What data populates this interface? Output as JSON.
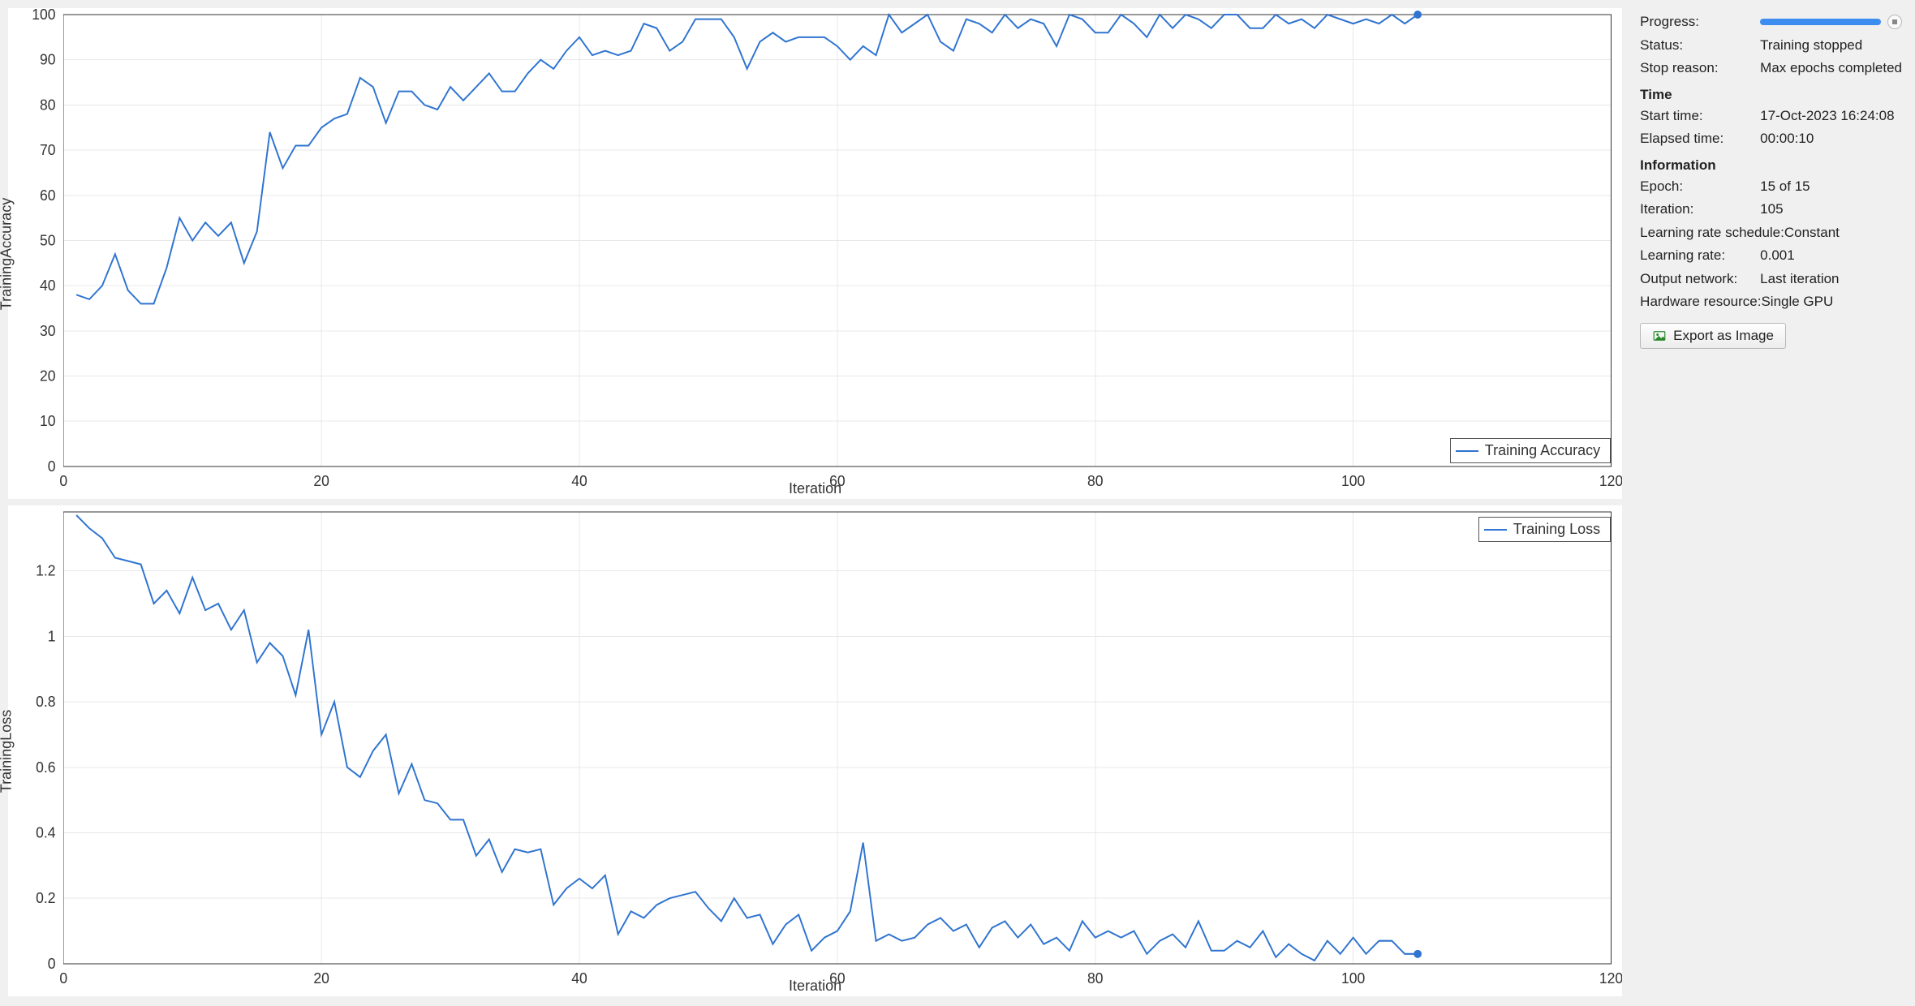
{
  "info": {
    "progress_label": "Progress:",
    "progress_pct": 100,
    "status_label": "Status:",
    "status_value": "Training stopped",
    "stopreason_label": "Stop reason:",
    "stopreason_value": "Max epochs completed",
    "time_header": "Time",
    "starttime_label": "Start time:",
    "starttime_value": "17-Oct-2023 16:24:08",
    "elapsed_label": "Elapsed time:",
    "elapsed_value": "00:00:10",
    "information_header": "Information",
    "epoch_label": "Epoch:",
    "epoch_value": "15 of 15",
    "iteration_label": "Iteration:",
    "iteration_value": "105",
    "lrsched_label": "Learning rate schedule:",
    "lrsched_value": "Constant",
    "lrate_label": "Learning rate:",
    "lrate_value": "0.001",
    "outnet_label": "Output network:",
    "outnet_value": "Last iteration",
    "hw_label": "Hardware resource:",
    "hw_value": "Single GPU",
    "export_label": "Export as Image"
  },
  "chart_data": [
    {
      "id": "accuracy",
      "type": "line",
      "xlabel": "Iteration",
      "ylabel": "TrainingAccuracy",
      "xlim": [
        0,
        120
      ],
      "ylim": [
        0,
        100
      ],
      "xticks": [
        0,
        20,
        40,
        60,
        80,
        100,
        120
      ],
      "yticks": [
        0,
        10,
        20,
        30,
        40,
        50,
        60,
        70,
        80,
        90,
        100
      ],
      "legend_pos": "bottom-right",
      "series": [
        {
          "name": "Training Accuracy",
          "color": "#2f74d0",
          "x": [
            1,
            2,
            3,
            4,
            5,
            6,
            7,
            8,
            9,
            10,
            11,
            12,
            13,
            14,
            15,
            16,
            17,
            18,
            19,
            20,
            21,
            22,
            23,
            24,
            25,
            26,
            27,
            28,
            29,
            30,
            31,
            32,
            33,
            34,
            35,
            36,
            37,
            38,
            39,
            40,
            41,
            42,
            43,
            44,
            45,
            46,
            47,
            48,
            49,
            50,
            51,
            52,
            53,
            54,
            55,
            56,
            57,
            58,
            59,
            60,
            61,
            62,
            63,
            64,
            65,
            66,
            67,
            68,
            69,
            70,
            71,
            72,
            73,
            74,
            75,
            76,
            77,
            78,
            79,
            80,
            81,
            82,
            83,
            84,
            85,
            86,
            87,
            88,
            89,
            90,
            91,
            92,
            93,
            94,
            95,
            96,
            97,
            98,
            99,
            100,
            101,
            102,
            103,
            104,
            105
          ],
          "y": [
            38,
            37,
            40,
            47,
            39,
            36,
            36,
            44,
            55,
            50,
            54,
            51,
            54,
            45,
            52,
            74,
            66,
            71,
            71,
            75,
            77,
            78,
            86,
            84,
            76,
            83,
            83,
            80,
            79,
            84,
            81,
            84,
            87,
            83,
            83,
            87,
            90,
            88,
            92,
            95,
            91,
            92,
            91,
            92,
            98,
            97,
            92,
            94,
            99,
            99,
            99,
            95,
            88,
            94,
            96,
            94,
            95,
            95,
            95,
            93,
            90,
            93,
            91,
            100,
            96,
            98,
            100,
            94,
            92,
            99,
            98,
            96,
            100,
            97,
            99,
            98,
            93,
            100,
            99,
            96,
            96,
            100,
            98,
            95,
            100,
            97,
            100,
            99,
            97,
            100,
            100,
            97,
            97,
            100,
            98,
            99,
            97,
            100,
            99,
            98,
            99,
            98,
            100,
            98,
            100
          ]
        }
      ]
    },
    {
      "id": "loss",
      "type": "line",
      "xlabel": "Iteration",
      "ylabel": "TrainingLoss",
      "xlim": [
        0,
        120
      ],
      "ylim": [
        0,
        1.38
      ],
      "xticks": [
        0,
        20,
        40,
        60,
        80,
        100,
        120
      ],
      "yticks": [
        0,
        0.2,
        0.4,
        0.6,
        0.8,
        1,
        1.2
      ],
      "legend_pos": "top-right",
      "series": [
        {
          "name": "Training Loss",
          "color": "#2f74d0",
          "x": [
            1,
            2,
            3,
            4,
            5,
            6,
            7,
            8,
            9,
            10,
            11,
            12,
            13,
            14,
            15,
            16,
            17,
            18,
            19,
            20,
            21,
            22,
            23,
            24,
            25,
            26,
            27,
            28,
            29,
            30,
            31,
            32,
            33,
            34,
            35,
            36,
            37,
            38,
            39,
            40,
            41,
            42,
            43,
            44,
            45,
            46,
            47,
            48,
            49,
            50,
            51,
            52,
            53,
            54,
            55,
            56,
            57,
            58,
            59,
            60,
            61,
            62,
            63,
            64,
            65,
            66,
            67,
            68,
            69,
            70,
            71,
            72,
            73,
            74,
            75,
            76,
            77,
            78,
            79,
            80,
            81,
            82,
            83,
            84,
            85,
            86,
            87,
            88,
            89,
            90,
            91,
            92,
            93,
            94,
            95,
            96,
            97,
            98,
            99,
            100,
            101,
            102,
            103,
            104,
            105
          ],
          "y": [
            1.37,
            1.33,
            1.3,
            1.24,
            1.23,
            1.22,
            1.1,
            1.14,
            1.07,
            1.18,
            1.08,
            1.1,
            1.02,
            1.08,
            0.92,
            0.98,
            0.94,
            0.82,
            1.02,
            0.7,
            0.8,
            0.6,
            0.57,
            0.65,
            0.7,
            0.52,
            0.61,
            0.5,
            0.49,
            0.44,
            0.44,
            0.33,
            0.38,
            0.28,
            0.35,
            0.34,
            0.35,
            0.18,
            0.23,
            0.26,
            0.23,
            0.27,
            0.09,
            0.16,
            0.14,
            0.18,
            0.2,
            0.21,
            0.22,
            0.17,
            0.13,
            0.2,
            0.14,
            0.15,
            0.06,
            0.12,
            0.15,
            0.04,
            0.08,
            0.1,
            0.16,
            0.37,
            0.07,
            0.09,
            0.07,
            0.08,
            0.12,
            0.14,
            0.1,
            0.12,
            0.05,
            0.11,
            0.13,
            0.08,
            0.12,
            0.06,
            0.08,
            0.04,
            0.13,
            0.08,
            0.1,
            0.08,
            0.1,
            0.03,
            0.07,
            0.09,
            0.05,
            0.13,
            0.04,
            0.04,
            0.07,
            0.05,
            0.1,
            0.02,
            0.06,
            0.03,
            0.01,
            0.07,
            0.03,
            0.08,
            0.03,
            0.07,
            0.07,
            0.03,
            0.03
          ]
        }
      ]
    }
  ]
}
